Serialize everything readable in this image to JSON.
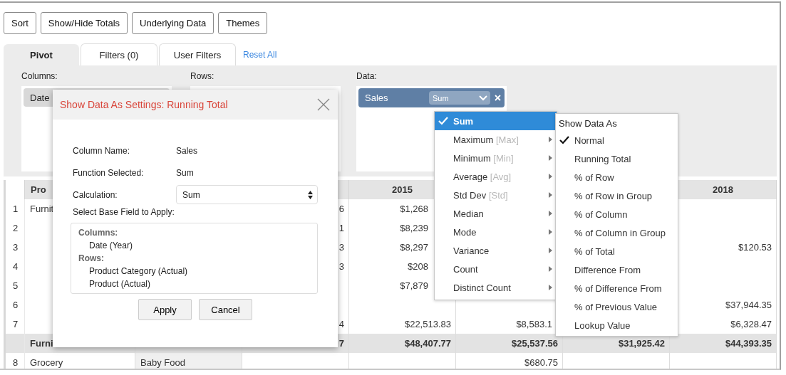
{
  "toolbar": [
    "Sort",
    "Show/Hide Totals",
    "Underlying Data",
    "Themes"
  ],
  "tabs": [
    {
      "label": "Pivot",
      "selected": true
    },
    {
      "label": "Filters (0)",
      "selected": false
    },
    {
      "label": "User Filters",
      "selected": false
    }
  ],
  "reset_link": "Reset All",
  "shelves": [
    {
      "label": "Columns:",
      "chips": [
        {
          "label": "Date"
        }
      ]
    },
    {
      "label": "Rows:"
    },
    {
      "label": "Data:",
      "chips": [
        {
          "label": "Sales",
          "function": "Sum"
        }
      ]
    }
  ],
  "table": {
    "header": {
      "column_2": "Pro",
      "column_5": "2015",
      "column_8": "2018"
    },
    "rows": [
      {
        "kind": "data",
        "cells": {
          "column_1": "1",
          "column_2": "Furnit",
          "column_4": "6",
          "column_5": "$1,268"
        }
      },
      {
        "kind": "data",
        "cells": {
          "column_1": "2",
          "column_4": "1",
          "column_5": "$8,239"
        }
      },
      {
        "kind": "data",
        "cells": {
          "column_1": "3",
          "column_4": "3",
          "column_5": "$8,297",
          "column_8": "$120.53"
        }
      },
      {
        "kind": "data",
        "cells": {
          "column_1": "4",
          "column_4": "3",
          "column_5": "$208"
        }
      },
      {
        "kind": "data",
        "cells": {
          "column_1": "5",
          "column_5": "$7,879"
        }
      },
      {
        "kind": "data",
        "cells": {
          "column_1": "6",
          "column_8": "$37,944.35"
        }
      },
      {
        "kind": "data",
        "cells": {
          "column_1": "7",
          "column_4": "4",
          "column_5": "$22,513.83",
          "column_6": "$8,583.1",
          "column_8": "$6,328.47"
        }
      },
      {
        "kind": "total",
        "cells": {
          "column_2": "Furni",
          "column_4": "7",
          "column_5": "$48,407.77",
          "column_6": "$25,537.56",
          "column_7": "$31,925.42",
          "column_8": "$44,393.35"
        }
      },
      {
        "kind": "data",
        "cells": {
          "column_1": "8",
          "column_2": "Grocery",
          "column_3": "Baby Food",
          "column_6": "$680.75"
        }
      }
    ]
  },
  "dialog": {
    "title": "Show Data As Settings: Running Total",
    "fields": [
      {
        "label": "Column Name:",
        "value": "Sales"
      },
      {
        "label": "Function Selected:",
        "value": "Sum"
      }
    ],
    "calculation": {
      "label": "Calculation:",
      "value": "Sum"
    },
    "base_field_label": "Select Base Field to Apply:",
    "base_fields": [
      {
        "group": "Columns:",
        "items": [
          "Date (Year)"
        ]
      },
      {
        "group": "Rows:",
        "items": [
          "Product Category (Actual)",
          "Product (Actual)"
        ]
      }
    ],
    "buttons": [
      "Apply",
      "Cancel"
    ]
  },
  "function_menu": [
    {
      "label": "Sum",
      "selected": true,
      "submenu": false
    },
    {
      "label": "Maximum",
      "hint": "[Max]",
      "selected": false,
      "submenu": true
    },
    {
      "label": "Minimum",
      "hint": "[Min]",
      "selected": false,
      "submenu": true
    },
    {
      "label": "Average",
      "hint": "[Avg]",
      "selected": false,
      "submenu": true
    },
    {
      "label": "Std Dev",
      "hint": "[Std]",
      "selected": false,
      "submenu": true
    },
    {
      "label": "Median",
      "selected": false,
      "submenu": true
    },
    {
      "label": "Mode",
      "selected": false,
      "submenu": true
    },
    {
      "label": "Variance",
      "selected": false,
      "submenu": true
    },
    {
      "label": "Count",
      "selected": false,
      "submenu": true
    },
    {
      "label": "Distinct Count",
      "selected": false,
      "submenu": true
    }
  ],
  "show_data_as": {
    "title": "Show Data As",
    "items": [
      {
        "label": "Normal",
        "selected": true
      },
      {
        "label": "Running Total",
        "selected": false
      },
      {
        "label": "% of Row",
        "selected": false
      },
      {
        "label": "% of Row in Group",
        "selected": false
      },
      {
        "label": "% of Column",
        "selected": false
      },
      {
        "label": "% of Column in Group",
        "selected": false
      },
      {
        "label": "% of Total",
        "selected": false
      },
      {
        "label": "Difference From",
        "selected": false
      },
      {
        "label": "% of Difference From",
        "selected": false
      },
      {
        "label": "% of Previous Value",
        "selected": false
      },
      {
        "label": "Lookup Value",
        "selected": false
      }
    ]
  }
}
